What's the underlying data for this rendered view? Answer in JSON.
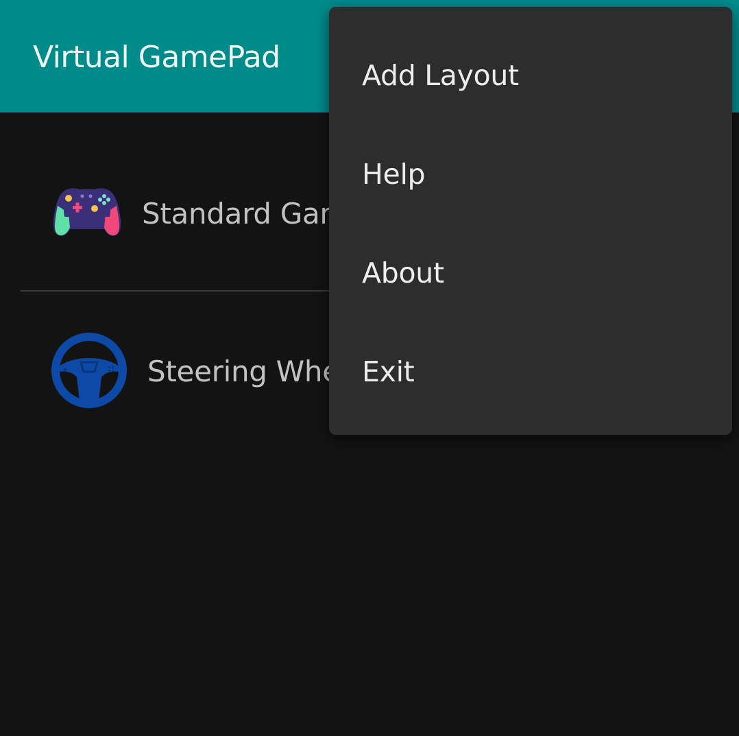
{
  "app_bar": {
    "title": "Virtual GamePad",
    "color": "#008b8b"
  },
  "layouts": [
    {
      "label": "Standard Gam",
      "icon": "gamepad-icon"
    },
    {
      "label": "Steering Whee",
      "icon": "steering-wheel-icon"
    }
  ],
  "menu": {
    "items": [
      {
        "label": "Add Layout"
      },
      {
        "label": "Help"
      },
      {
        "label": "About"
      },
      {
        "label": "Exit"
      }
    ]
  },
  "colors": {
    "background": "#131313",
    "menu_background": "#2d2d2d",
    "accent": "#008b8b",
    "list_text": "#c2c2c2",
    "menu_text": "#ededed"
  }
}
